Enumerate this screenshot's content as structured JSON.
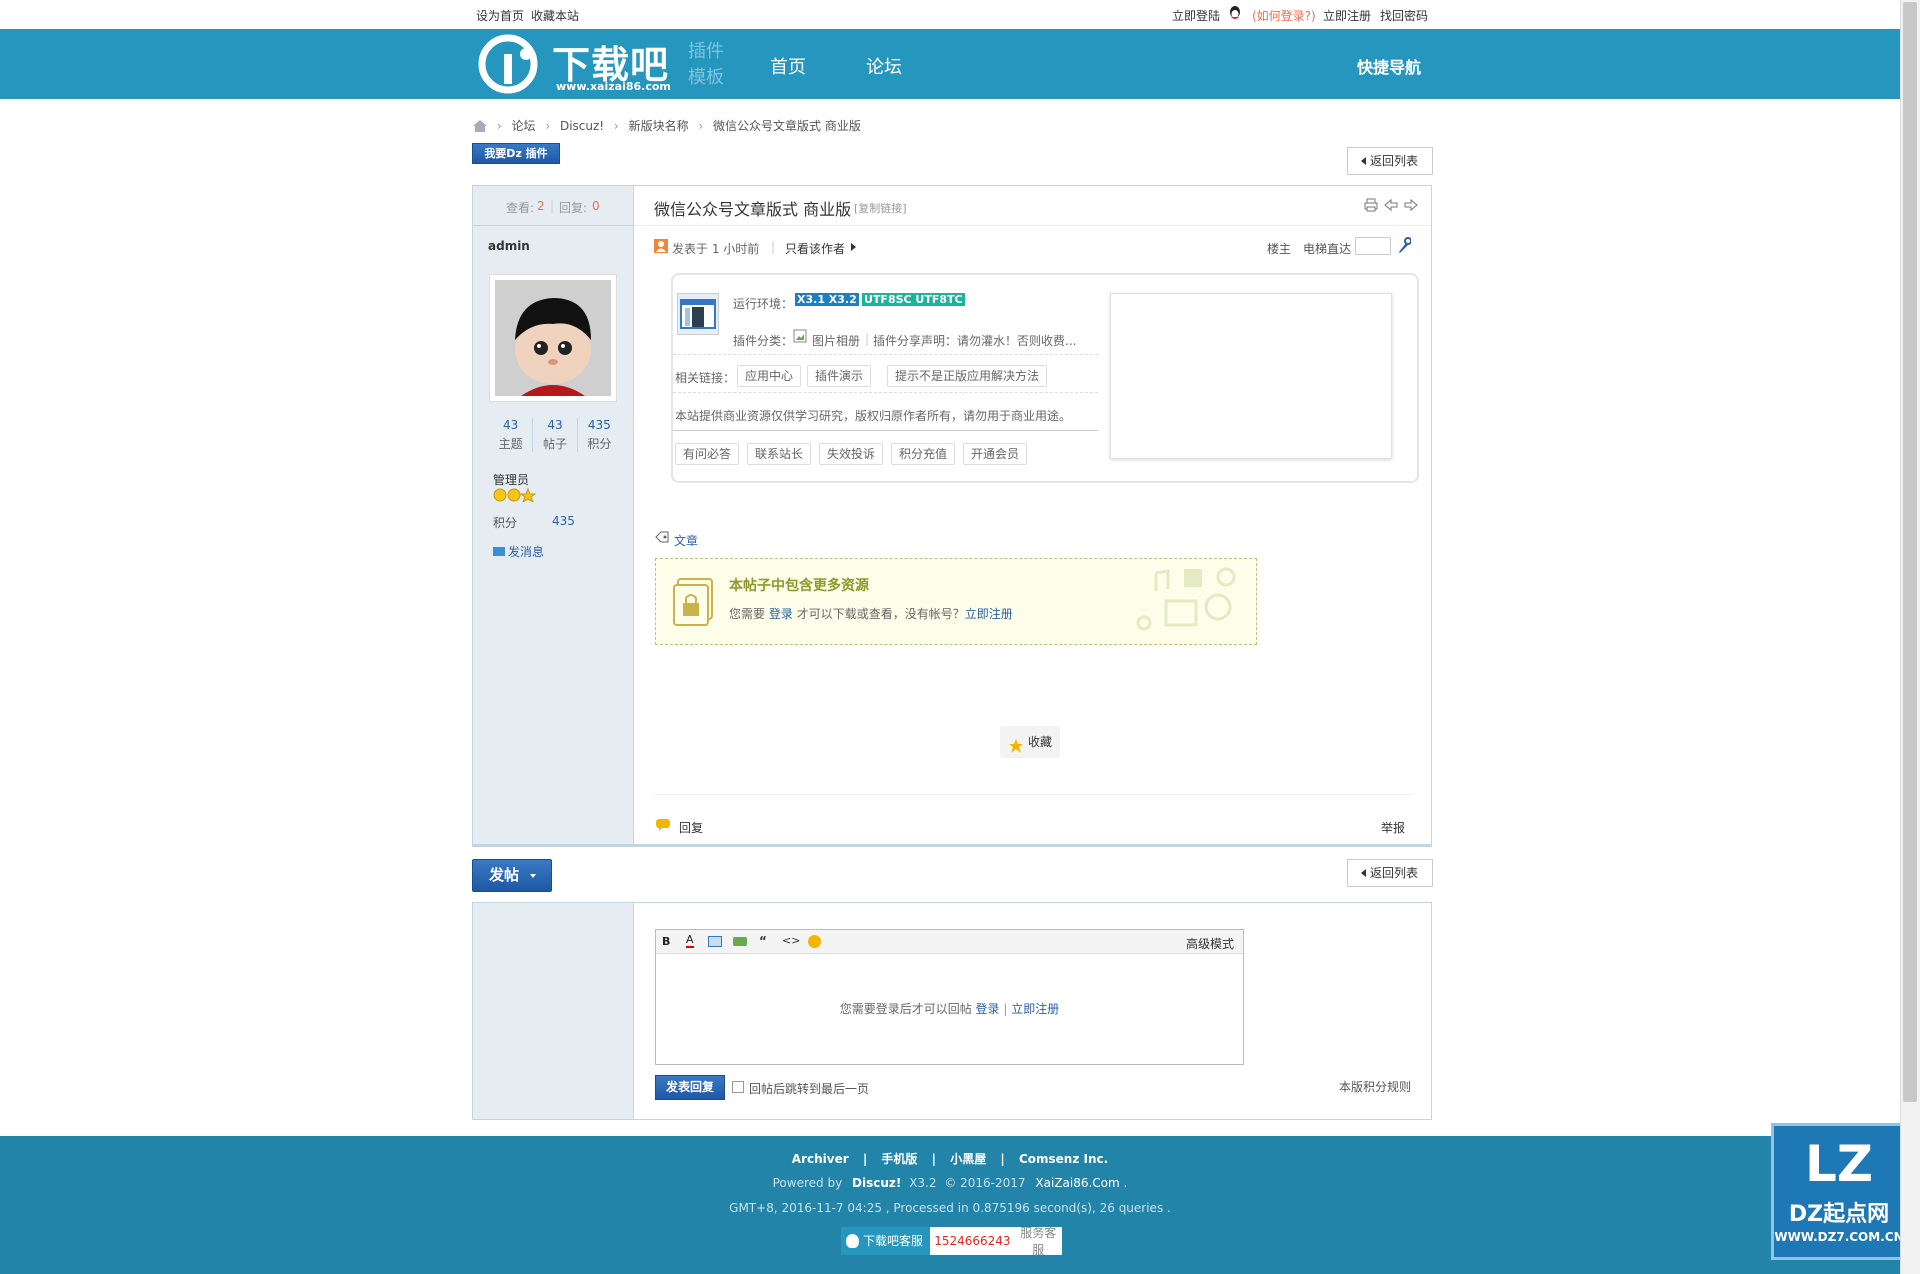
{
  "topbar": {
    "set_home": "设为首页",
    "bookmark": "收藏本站",
    "login_now": "立即登陆",
    "how_login": "(如何登录?)",
    "register_now": "立即注册",
    "find_password": "找回密码"
  },
  "header": {
    "logo_text": "下载吧",
    "logo_url": "www.xaizai86.com",
    "logo_sub1": "插件",
    "logo_sub2": "模板",
    "nav": [
      "首页",
      "论坛"
    ],
    "quick_nav": "快捷导航"
  },
  "breadcrumb": {
    "items": [
      "论坛",
      "Discuz!",
      "新版块名称",
      "微信公众号文章版式 商业版"
    ]
  },
  "buttons": {
    "want_plugin": "我要Dz 插件",
    "back_list": "返回列表",
    "post_new": "发帖",
    "submit_reply": "发表回复",
    "favorite": "收藏"
  },
  "thread": {
    "views_label": "查看:",
    "views": "2",
    "replies_label": "回复:",
    "replies": "0",
    "title": "微信公众号文章版式 商业版",
    "copy_link": "[复制链接]",
    "posted_at": "发表于 1 小时前",
    "only_author": "只看该作者",
    "floor": "楼主",
    "elevator": "电梯直达"
  },
  "author": {
    "name": "admin",
    "stats": [
      {
        "value": "43",
        "label": "主题"
      },
      {
        "value": "43",
        "label": "帖子"
      },
      {
        "value": "435",
        "label": "积分"
      }
    ],
    "group": "管理员",
    "points_label": "积分",
    "points": "435",
    "send_msg": "发消息"
  },
  "plugin_card": {
    "env_label": "运行环境：",
    "env_badge1": "X3.1 X3.2",
    "env_badge2": "UTF8SC UTF8TC",
    "category_label": "插件分类：",
    "category": "图片相册",
    "share_notice": "插件分享声明：请勿灌水！否则收费...",
    "links_label": "相关链接：",
    "links": [
      "应用中心",
      "插件演示",
      "提示不是正版应用解决方法"
    ],
    "disclaimer": "本站提供商业资源仅供学习研究，版权归原作者所有，请勿用于商业用途。",
    "actions": [
      "有问必答",
      "联系站长",
      "失效投诉",
      "积分充值",
      "开通会员"
    ]
  },
  "tag": "文章",
  "locked": {
    "title": "本帖子中包含更多资源",
    "text_pre": "您需要",
    "login": "登录",
    "text_mid": "才可以下载或查看，没有帐号？",
    "register": "立即注册"
  },
  "post_footer": {
    "reply": "回复",
    "report": "举报"
  },
  "editor": {
    "advanced": "高级模式",
    "login_hint": "您需要登录后才可以回帖",
    "login": "登录",
    "sep": "|",
    "register": "立即注册",
    "jump_last": "回帖后跳转到最后一页",
    "credit_rule": "本版积分规则"
  },
  "footer": {
    "links": [
      "Archiver",
      "手机版",
      "小黑屋",
      "Comsenz Inc."
    ],
    "powered_by": "Powered by",
    "discuz": "Discuz!",
    "version": "X3.2",
    "copyright": "© 2016-2017",
    "site": "XaiZai86.Com",
    "gmt_line": "GMT+8, 2016-11-7 04:25 , Processed in 0.875196 second(s), 26 queries .",
    "service_label": "下载吧客服",
    "service_qq": "1524666243",
    "service_tail": "服务客服"
  },
  "watermark": {
    "brand": "DZ起点网",
    "url": "WWW.DZ7.COM.CN"
  },
  "colors": {
    "header_bg": "#2596be",
    "footer_bg": "#2184a8",
    "link": "#2b5fa8",
    "accent_red": "#f26c4f"
  }
}
